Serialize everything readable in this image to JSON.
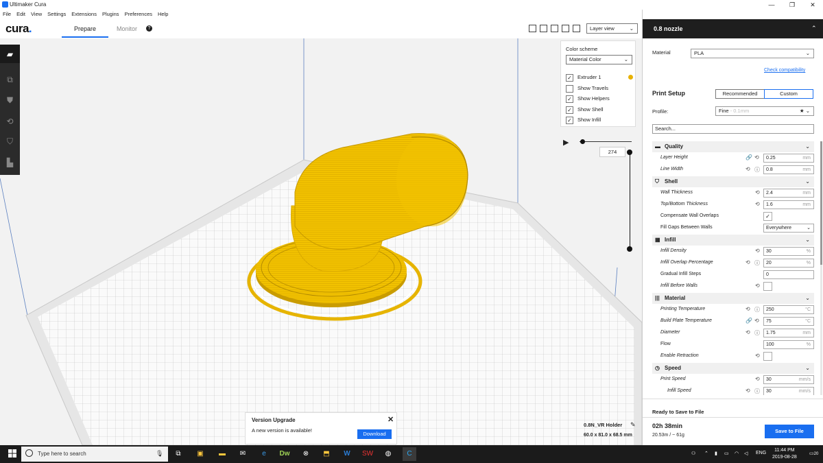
{
  "window": {
    "title": "Ultimaker Cura",
    "minimize": "—",
    "maximize": "❐",
    "close": "✕"
  },
  "menu": [
    "File",
    "Edit",
    "View",
    "Settings",
    "Extensions",
    "Plugins",
    "Preferences",
    "Help"
  ],
  "header": {
    "logo": "cura",
    "tabs": [
      "Prepare",
      "Monitor"
    ],
    "active_tab": "Prepare"
  },
  "view": {
    "layer_view": "Layer view",
    "color_scheme_label": "Color scheme",
    "color_scheme_value": "Material Color",
    "options": [
      {
        "label": "Extruder 1",
        "checked": true
      },
      {
        "label": "Show Travels",
        "checked": false
      },
      {
        "label": "Show Helpers",
        "checked": true
      },
      {
        "label": "Show Shell",
        "checked": true
      },
      {
        "label": "Show Infill",
        "checked": true
      }
    ],
    "extruder_color": "#e8b100",
    "layer_number": "274"
  },
  "notification": {
    "title": "Version Upgrade",
    "message": "A new version is available!",
    "button": "Download",
    "close": "✕"
  },
  "object": {
    "name": "0.8N_VR Holder",
    "dimensions": "60.0 x 81.0 x 68.5 mm"
  },
  "sidebar": {
    "nozzle": "0.8 nozzle",
    "material_label": "Material",
    "material_value": "PLA",
    "check_compat": "Check compatibility",
    "print_setup": "Print Setup",
    "recommended": "Recommended",
    "custom": "Custom",
    "profile_label": "Profile:",
    "profile_value": "Fine",
    "profile_sub": "- 0.1mm",
    "search_placeholder": "Search...",
    "categories": [
      {
        "name": "Quality",
        "icon": "quality-icon",
        "glyph": "▬",
        "settings": [
          {
            "label": "Layer Height",
            "value": "0.25",
            "unit": "mm",
            "italic": true,
            "icons": [
              "link-icon",
              "reset-icon"
            ]
          },
          {
            "label": "Line Width",
            "value": "0.8",
            "unit": "mm",
            "italic": true,
            "icons": [
              "reset-icon",
              "info-icon"
            ]
          }
        ]
      },
      {
        "name": "Shell",
        "icon": "shell-icon",
        "glyph": "⛉",
        "settings": [
          {
            "label": "Wall Thickness",
            "value": "2.4",
            "unit": "mm",
            "italic": true,
            "icons": [
              "reset-icon"
            ]
          },
          {
            "label": "Top/Bottom Thickness",
            "value": "1.6",
            "unit": "mm",
            "italic": true,
            "icons": [
              "reset-icon"
            ]
          },
          {
            "label": "Compensate Wall Overlaps",
            "type": "checkbox",
            "checked": true,
            "italic": false,
            "icons": []
          },
          {
            "label": "Fill Gaps Between Walls",
            "type": "select",
            "value": "Everywhere",
            "italic": false,
            "icons": []
          }
        ]
      },
      {
        "name": "Infill",
        "icon": "infill-icon",
        "glyph": "▦",
        "settings": [
          {
            "label": "Infill Density",
            "value": "30",
            "unit": "%",
            "italic": true,
            "icons": [
              "reset-icon"
            ]
          },
          {
            "label": "Infill Overlap Percentage",
            "value": "20",
            "unit": "%",
            "italic": true,
            "icons": [
              "reset-icon",
              "info-icon"
            ]
          },
          {
            "label": "Gradual Infill Steps",
            "value": "0",
            "unit": "",
            "italic": false,
            "icons": []
          },
          {
            "label": "Infill Before Walls",
            "type": "checkbox",
            "checked": false,
            "italic": true,
            "icons": [
              "reset-icon"
            ]
          }
        ]
      },
      {
        "name": "Material",
        "icon": "material-icon",
        "glyph": "|||",
        "settings": [
          {
            "label": "Printing Temperature",
            "value": "250",
            "unit": "°C",
            "italic": true,
            "icons": [
              "reset-icon",
              "info-icon"
            ]
          },
          {
            "label": "Build Plate Temperature",
            "value": "75",
            "unit": "°C",
            "italic": true,
            "icons": [
              "link-icon",
              "reset-icon"
            ]
          },
          {
            "label": "Diameter",
            "value": "1.75",
            "unit": "mm",
            "italic": true,
            "icons": [
              "reset-icon",
              "info-icon"
            ]
          },
          {
            "label": "Flow",
            "value": "100",
            "unit": "%",
            "italic": false,
            "icons": []
          },
          {
            "label": "Enable Retraction",
            "type": "checkbox",
            "checked": false,
            "italic": true,
            "icons": [
              "reset-icon"
            ]
          }
        ]
      },
      {
        "name": "Speed",
        "icon": "speed-icon",
        "glyph": "◷",
        "settings": [
          {
            "label": "Print Speed",
            "value": "30",
            "unit": "mm/s",
            "italic": true,
            "icons": [
              "reset-icon"
            ]
          },
          {
            "label": "Infill Speed",
            "value": "30",
            "unit": "mm/s",
            "italic": true,
            "indent": true,
            "icons": [
              "reset-icon",
              "info-icon"
            ]
          }
        ]
      }
    ],
    "save_status": "Ready to Save to File",
    "print_time": "02h 38min",
    "material_usage": "20.53m / ~ 61g",
    "save_button": "Save to File"
  },
  "taskbar": {
    "search_placeholder": "Type here to search",
    "language": "ENG",
    "time": "11:44 PM",
    "date": "2019-08-28",
    "notifications": "20"
  },
  "colors": {
    "accent": "#196ef0",
    "model": "#f2c200",
    "model_dark": "#b98f00"
  }
}
